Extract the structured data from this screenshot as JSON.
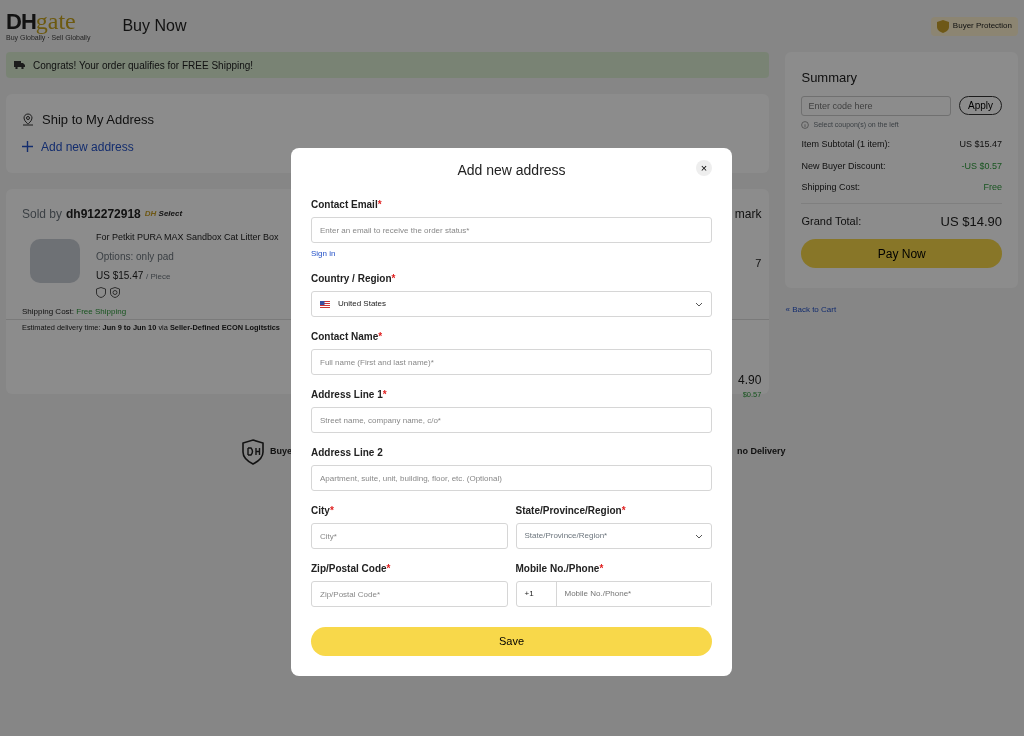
{
  "header": {
    "logo": {
      "mark": "DH",
      "word": "gate",
      "tagline": "Buy Globally · Sell Globally"
    },
    "title": "Buy Now",
    "badge": "Buyer Protection"
  },
  "banner": "Congrats! Your order qualifies for FREE Shipping!",
  "ship": {
    "title": "Ship to My Address",
    "add_link": "Add new address"
  },
  "order": {
    "sold_by": "Sold by",
    "seller": "dh912272918",
    "seller_badge": {
      "mark": "DH",
      "text": "Select"
    },
    "product": {
      "title": "For Petkit PURA MAX Sandbox Cat Litter Box",
      "options": "Options: only pad",
      "price": "US $15.47",
      "unit": "/ Piece"
    },
    "shipping_label": "Shipping Cost:",
    "shipping_value": "Free Shipping",
    "delivery_label": "Estimated delivery time:",
    "delivery_dates": "Jun 9 to Jun 10",
    "delivery_via": "via",
    "delivery_method": "Seller-Defined ECON Logitstics",
    "column_remark": "mark",
    "column_price": "7",
    "total": "4.90",
    "discount": "$0.57"
  },
  "footer": {
    "left": "Buye",
    "right": "no Delivery"
  },
  "summary": {
    "title": "Summary",
    "coupon_placeholder": "Enter code here",
    "apply": "Apply",
    "hint": "Select coupon(s) on the left",
    "rows": [
      {
        "label": "Item Subtotal (1 item):",
        "value": "US $15.47",
        "kind": "plain"
      },
      {
        "label": "New Buyer Discount:",
        "value": "-US $0.57",
        "kind": "discount"
      },
      {
        "label": "Shipping Cost:",
        "value": "Free",
        "kind": "discount"
      }
    ],
    "grand_label": "Grand Total:",
    "grand_value": "US $14.90",
    "pay": "Pay Now",
    "back": "« Back to Cart"
  },
  "modal": {
    "title": "Add new address",
    "close": "×",
    "rows": [
      {
        "fields": [
          {
            "label": "Contact Email",
            "required_mark": "*",
            "kind": "text",
            "placeholder": "Enter an email to receive the order status*",
            "link": "Sign in"
          }
        ]
      },
      {
        "fields": [
          {
            "label": "Country / Region",
            "required_mark": "*",
            "kind": "select",
            "value": "United States",
            "flag": true
          }
        ]
      },
      {
        "fields": [
          {
            "label": "Contact Name",
            "required_mark": "*",
            "kind": "text",
            "placeholder": "Full name (First and last name)*"
          }
        ]
      },
      {
        "fields": [
          {
            "label": "Address Line 1",
            "required_mark": "*",
            "kind": "text",
            "placeholder": "Street name, company name, c/o*"
          }
        ]
      },
      {
        "fields": [
          {
            "label": "Address Line 2",
            "kind": "text",
            "placeholder": "Apartment, suite, unit, building, floor, etc. (Optional)"
          }
        ]
      },
      {
        "fields": [
          {
            "label": "City",
            "required_mark": "*",
            "kind": "text",
            "placeholder": "City*"
          },
          {
            "label": "State/Province/Region",
            "required_mark": "*",
            "kind": "select",
            "placeholder": "State/Province/Region*"
          }
        ]
      },
      {
        "fields": [
          {
            "label": "Zip/Postal Code",
            "required_mark": "*",
            "kind": "text",
            "placeholder": "Zip/Postal Code*"
          },
          {
            "label": "Mobile No./Phone",
            "required_mark": "*",
            "kind": "phone",
            "prefix": "+1",
            "placeholder": "Mobile No./Phone*"
          }
        ]
      }
    ],
    "save": "Save"
  }
}
